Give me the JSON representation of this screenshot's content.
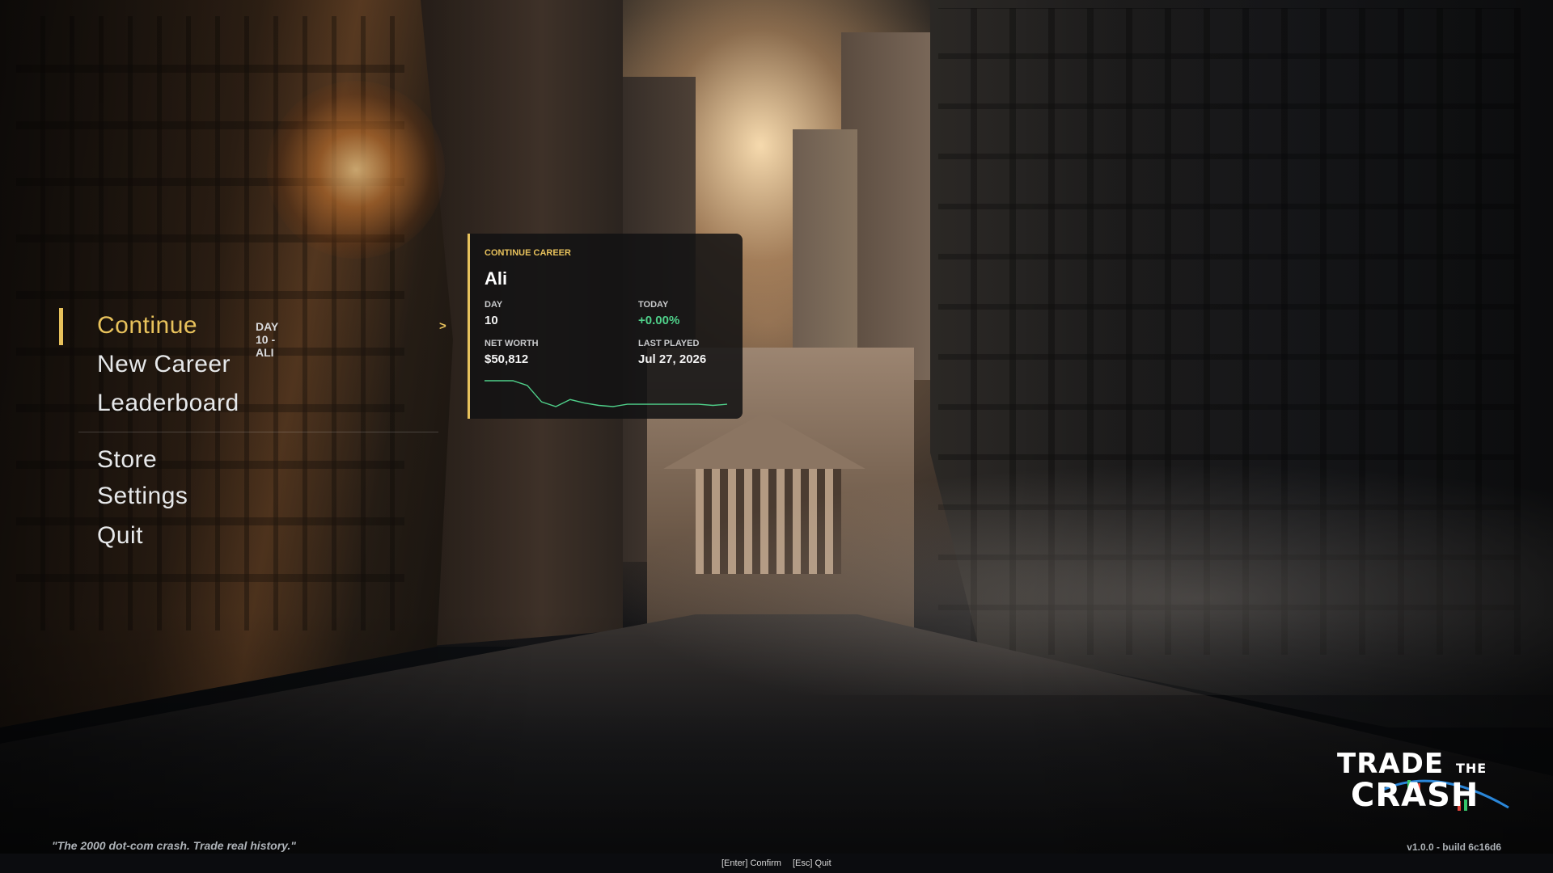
{
  "menu": {
    "items": [
      {
        "label": "Continue",
        "active": true
      },
      {
        "label": "New Career"
      },
      {
        "label": "Leaderboard"
      },
      {
        "label": "Store"
      },
      {
        "label": "Settings"
      },
      {
        "label": "Quit"
      }
    ],
    "continue_hint": "DAY 10 - ALI",
    "continue_arrow": ">"
  },
  "career_card": {
    "tag": "CONTINUE CAREER",
    "name": "Ali",
    "day_label": "DAY",
    "day_value": "10",
    "today_label": "TODAY",
    "today_value": "+0.00%",
    "net_worth_label": "NET WORTH",
    "net_worth_value": "$50,812",
    "last_played_label": "LAST PLAYED",
    "last_played_value": "Jul 27, 2026",
    "sparkline_values": [
      52,
      52,
      52,
      51.6,
      50.2,
      49.8,
      50.4,
      50.1,
      49.9,
      49.8,
      50.0,
      50.0,
      50.0,
      50.0,
      50.0,
      50.0,
      49.9,
      50.0
    ]
  },
  "footer": {
    "quote": "\"The 2000 dot-com crash. Trade real history.\"",
    "version": "v1.0.0 - build 6c16d6",
    "hint_confirm": "[Enter] Confirm",
    "hint_quit": "[Esc] Quit"
  },
  "logo": {
    "line1": "TRADE",
    "the": "THE",
    "line2": "CRASH"
  },
  "colors": {
    "accent": "#e8c25c",
    "positive": "#4fd08a",
    "spark_line": "#4fd08a"
  }
}
